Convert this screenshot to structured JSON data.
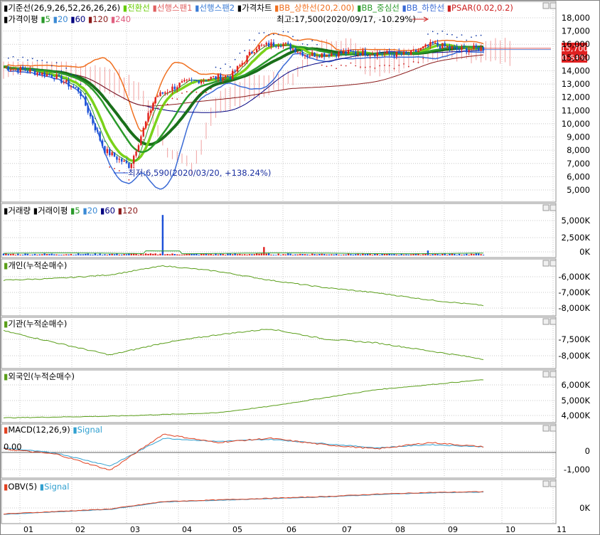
{
  "panels": {
    "price": {
      "legend_row1": [
        {
          "text": "기준선(26,9,26,52,26,26,26)",
          "color": "#000000"
        },
        {
          "text": "전환선",
          "color": "#66cc00"
        },
        {
          "text": "선행스팬1",
          "color": "#e06060"
        },
        {
          "text": "선행스팬2",
          "color": "#3a7bd5"
        },
        {
          "text": "가격차트",
          "color": "#000000"
        },
        {
          "text": "BB_상한선(20,2.00)",
          "color": "#f07020"
        },
        {
          "text": "BB_중심선",
          "color": "#2a9a2a"
        },
        {
          "text": "BB_하한선",
          "color": "#3a6ad5"
        },
        {
          "text": "PSAR(0.02,0.2)",
          "color": "#cc2222"
        }
      ],
      "legend_row2": [
        {
          "text": "가격이평",
          "color": "#000000"
        },
        {
          "text": "5",
          "color": "#2a9a2a"
        },
        {
          "text": "20",
          "color": "#3a8ad5"
        },
        {
          "text": "60",
          "color": "#000080"
        },
        {
          "text": "120",
          "color": "#8b1a1a"
        },
        {
          "text": "240",
          "color": "#e06080"
        }
      ],
      "high_label": "최고:17,500(2020/09/17, -10.29%)",
      "low_label": "최저:6,590(2020/03/20, +138.24%)",
      "current_price": "15,700",
      "current_change": "(0.64%)",
      "y_ticks": [
        "18,000",
        "17,000",
        "16,000",
        "15,000",
        "14,000",
        "13,000",
        "12,000",
        "11,000",
        "10,000",
        "9,000",
        "8,000",
        "7,000",
        "6,000",
        "5,000"
      ]
    },
    "volume": {
      "legend": [
        {
          "text": "거래량",
          "color": "#000000"
        },
        {
          "text": "거래이평",
          "color": "#000000"
        },
        {
          "text": "5",
          "color": "#2a9a2a"
        },
        {
          "text": "20",
          "color": "#3a8ad5"
        },
        {
          "text": "60",
          "color": "#000080"
        },
        {
          "text": "120",
          "color": "#8b1a1a"
        }
      ],
      "y_ticks": [
        "5,000K",
        "2,500K",
        "0K"
      ]
    },
    "individual": {
      "legend": "개인(누적순매수)",
      "y_ticks": [
        "-6,000K",
        "-7,000K",
        "-8,000K"
      ]
    },
    "institution": {
      "legend": "기관(누적순매수)",
      "y_ticks": [
        "-7,500K",
        "-8,000K"
      ]
    },
    "foreign": {
      "legend": "외국인(누적순매수)",
      "y_ticks": [
        "6,000K",
        "5,000K",
        "4,000K"
      ]
    },
    "macd": {
      "legend": "MACD(12,26,9)",
      "signal": "Signal",
      "zero_label": "0.00",
      "y_ticks": [
        "0",
        "-1,000"
      ]
    },
    "obv": {
      "legend": "OBV(5)",
      "signal": "Signal",
      "y_ticks": [
        "0K"
      ]
    }
  },
  "x_axis": [
    "01",
    "02",
    "03",
    "04",
    "05",
    "06",
    "07",
    "08",
    "09",
    "10",
    "11"
  ],
  "colors": {
    "up": "#e02020",
    "down": "#1a4fd8",
    "ma5": "#2a9a2a",
    "line_green": "#5a9e1a",
    "grid": "#b8b8b8",
    "macd": "#e04020",
    "signal": "#30a0d0"
  },
  "chart_data": [
    {
      "type": "candlestick",
      "title": "가격차트",
      "ylim": [
        4500,
        18500
      ],
      "high": {
        "value": 17500,
        "date": "2020/09/17"
      },
      "low": {
        "value": 6590,
        "date": "2020/03/20"
      },
      "last": 15700,
      "x": [
        "01",
        "02",
        "03",
        "04",
        "05",
        "06",
        "07",
        "08",
        "09",
        "10"
      ],
      "close_monthly_approx": [
        14300,
        13000,
        8000,
        13200,
        13300,
        16000,
        15200,
        15400,
        15200,
        15700
      ],
      "series": [
        {
          "name": "BB_상한선",
          "color": "#f07020",
          "values": [
            14800,
            14000,
            12000,
            14600,
            13500,
            16500,
            15900,
            16000,
            16100,
            16400
          ]
        },
        {
          "name": "BB_하한선",
          "color": "#3a6ad5",
          "values": [
            13200,
            11500,
            6000,
            11000,
            12800,
            14600,
            14200,
            14600,
            14500,
            14900
          ]
        }
      ]
    },
    {
      "type": "bar",
      "title": "거래량",
      "ylim": [
        0,
        6500
      ],
      "unit": "K",
      "peaks": [
        {
          "x": "04",
          "value": 5800
        },
        {
          "x": "06",
          "value": 1200
        },
        {
          "x": "09",
          "value": 700
        }
      ]
    },
    {
      "type": "line",
      "title": "개인(누적순매수)",
      "ylim": [
        -8400,
        -5400
      ],
      "unit": "K",
      "x": [
        "01",
        "02",
        "03",
        "04",
        "05",
        "06",
        "07",
        "08",
        "09",
        "10"
      ],
      "values": [
        -6500,
        -6400,
        -6200,
        -5700,
        -6000,
        -6500,
        -6900,
        -7200,
        -7600,
        -7900
      ]
    },
    {
      "type": "line",
      "title": "기관(누적순매수)",
      "ylim": [
        -8300,
        -7100
      ],
      "unit": "K",
      "x": [
        "01",
        "02",
        "03",
        "04",
        "05",
        "06",
        "07",
        "08",
        "09",
        "10"
      ],
      "values": [
        -7400,
        -7700,
        -8000,
        -7700,
        -7500,
        -7350,
        -7600,
        -7700,
        -7900,
        -8100
      ]
    },
    {
      "type": "line",
      "title": "외국인(누적순매수)",
      "ylim": [
        3700,
        6700
      ],
      "unit": "K",
      "x": [
        "01",
        "02",
        "03",
        "04",
        "05",
        "06",
        "07",
        "08",
        "09",
        "10"
      ],
      "values": [
        3900,
        3950,
        4000,
        4100,
        4200,
        4600,
        5100,
        5600,
        5900,
        6200
      ]
    },
    {
      "type": "line",
      "title": "MACD(12,26,9)",
      "ylim": [
        -1400,
        1000
      ],
      "x": [
        "01",
        "02",
        "03",
        "04",
        "05",
        "06",
        "07",
        "08",
        "09",
        "10"
      ],
      "series": [
        {
          "name": "MACD",
          "values": [
            -100,
            -350,
            -1100,
            600,
            200,
            400,
            100,
            -100,
            200,
            0
          ]
        },
        {
          "name": "Signal",
          "values": [
            -50,
            -300,
            -900,
            400,
            250,
            350,
            150,
            -50,
            100,
            0
          ]
        }
      ]
    },
    {
      "type": "line",
      "title": "OBV(5)",
      "unit": "K",
      "x": [
        "01",
        "02",
        "03",
        "04",
        "05",
        "06",
        "07",
        "08",
        "09",
        "10"
      ],
      "values": [
        -1500,
        -1200,
        -900,
        0,
        200,
        400,
        600,
        900,
        1100,
        1200
      ]
    }
  ]
}
